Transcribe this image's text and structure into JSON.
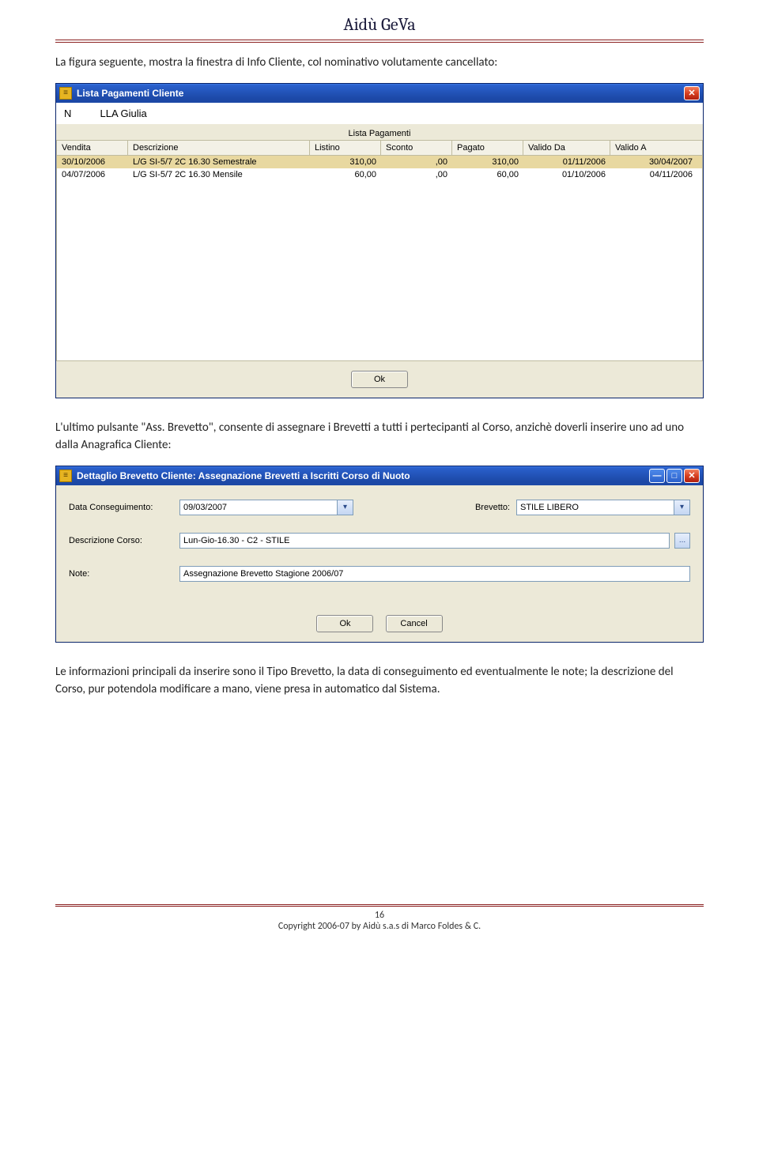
{
  "page": {
    "header_title": "Aidù GeVa",
    "intro_text": "La figura seguente, mostra la finestra di Info Cliente, col nominativo volutamente cancellato:",
    "mid_text_1": "L'ultimo pulsante \"Ass. Brevetto\", consente di assegnare i Brevetti a tutti i pertecipanti al Corso, anzichè doverli inserire uno ad uno dalla Anagrafica Cliente:",
    "mid_text_2": "Le informazioni principali da inserire sono il Tipo Brevetto, la data di conseguimento ed eventualmente le note; la descrizione del Corso, pur potendola modificare a mano, viene presa in automatico dal Sistema.",
    "page_number": "16",
    "copyright": "Copyright 2006-07 by Aidù s.a.s di Marco Foldes & C."
  },
  "win1": {
    "title": "Lista Pagamenti Cliente",
    "client_prefix": "N",
    "client_name": "LLA Giulia",
    "subheader": "Lista Pagamenti",
    "columns": {
      "vendita": "Vendita",
      "descrizione": "Descrizione",
      "listino": "Listino",
      "sconto": "Sconto",
      "pagato": "Pagato",
      "valido_da": "Valido Da",
      "valido_a": "Valido A"
    },
    "rows": [
      {
        "vendita": "30/10/2006",
        "descrizione": "L/G SI-5/7 2C 16.30 Semestrale",
        "listino": "310,00",
        "sconto": ",00",
        "pagato": "310,00",
        "valido_da": "01/11/2006",
        "valido_a": "30/04/2007"
      },
      {
        "vendita": "04/07/2006",
        "descrizione": "L/G SI-5/7 2C 16.30 Mensile",
        "listino": "60,00",
        "sconto": ",00",
        "pagato": "60,00",
        "valido_da": "01/10/2006",
        "valido_a": "04/11/2006"
      }
    ],
    "ok_label": "Ok"
  },
  "win2": {
    "title": "Dettaglio Brevetto Cliente: Assegnazione Brevetti a Iscritti Corso di Nuoto",
    "labels": {
      "data_conseguimento": "Data Conseguimento:",
      "brevetto": "Brevetto:",
      "descrizione_corso": "Descrizione Corso:",
      "note": "Note:"
    },
    "values": {
      "data_conseguimento": "09/03/2007",
      "brevetto": "STILE LIBERO",
      "descrizione_corso": "Lun-Gio-16.30 - C2 - STILE",
      "note": "Assegnazione Brevetto Stagione 2006/07"
    },
    "browse_label": "...",
    "ok_label": "Ok",
    "cancel_label": "Cancel"
  }
}
